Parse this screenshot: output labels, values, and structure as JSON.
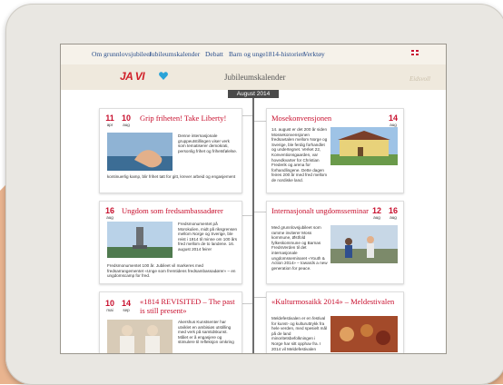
{
  "nav": {
    "items": [
      "Om grunnlovsjubileet",
      "Jubileumskalender",
      "Debatt",
      "Barn og unge",
      "1814-historien",
      "Verktøy"
    ]
  },
  "header": {
    "logo_text": "JA VI",
    "title": "Jubileumskalender",
    "signature": "Eidsvoll"
  },
  "timeline": {
    "month": "August 2014"
  },
  "cards": {
    "card1": {
      "date1_day": "11",
      "date1_month": "apr",
      "date2_day": "10",
      "date2_month": "aug",
      "title": "Grip friheten! Take Liberty!",
      "text1": "Denne internasjonale gruppeutstillingen viser verk som tematiserer demokrati, personlig frihet og frihetsfølelse.",
      "text2": "kontinuerlig kamp, blir frihet tatt for gitt, krever arbeid og engasjement"
    },
    "card2": {
      "date_day": "14",
      "date_month": "aug",
      "title": "Mosekonvensjonen",
      "text": "14. august er det 200 år siden Mossekonvensjonen fredsavtalen mellom Norge og Sverige, ble ferdig forhandlet og undertegnet. Verket 22, Konventionsgaarden, var hovedkvarter for Christian Frederik og arena for forhandlingene. Dette dagen feires 200 år med fred mellom de nordiske land."
    },
    "card3": {
      "date_day": "16",
      "date_month": "aug",
      "title": "Ungdom som fredsambassadører",
      "text1": "Fredsmonumentet på Morokulien, midt på riksgrensen mellom Norge og Sverige, ble reist i 1914 til minne om 100 års fred mellom de to landene. 16. august 2014 feirer",
      "text2": "Fredsmonumentet 100 år. Jubileet vil markeres med fredsarrangementet «Unge som fremtidens fredsambassadører» – en ungdomscamp for fred."
    },
    "card4": {
      "date1_day": "12",
      "date1_month": "aug",
      "date2_day": "16",
      "date2_month": "aug",
      "title": "Internasjonalt ungdomsseminar",
      "text": "Med grunnlovsjubileet som ramme inviterer Moss kommune, Østfold fylkeskommune og Barnas FredsVerden til det internasjonale ungdomsseminaret «Youth & Action 2014» – towards a new generation for peace."
    },
    "card5": {
      "date1_day": "10",
      "date1_month": "mai",
      "date2_day": "14",
      "date2_month": "sep",
      "title": "«1814 REVISITED – The past is still present»",
      "text": "Akershus Kunstsenter har utviklet en ambisiøs utstilling med verk på samtidskunst. Målet er å engasjere og stimulere til refleksjon omkring"
    },
    "card6": {
      "title": "«Kulturmosaikk 2014» – Meldestivalen",
      "text": "Meldefestivalen er en festival for kunst- og kulturuttrykk fra hele verden, med spesielt mål på de land minoritetsbefolkningen i Norge har sitt opphav fra. I 2014 vil Meldefestivalen"
    }
  },
  "colors": {
    "accent": "#c8102e",
    "link": "#2b4f8c",
    "timeline": "#4a4a4a"
  }
}
